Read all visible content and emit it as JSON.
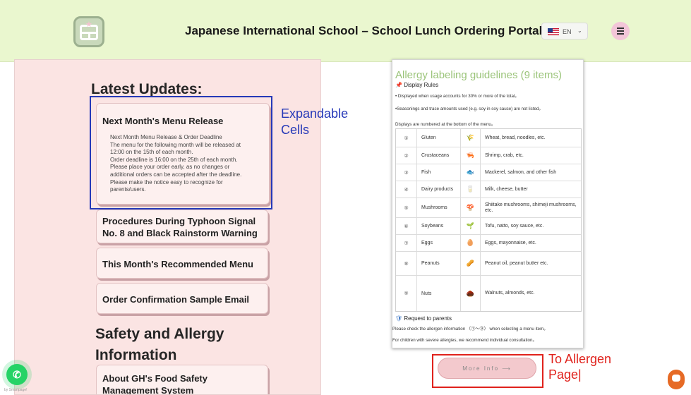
{
  "header": {
    "title": "Japanese International School – School Lunch Ordering Portal",
    "language": {
      "code": "EN"
    },
    "colors": {
      "header_bg": "#eaf7cf",
      "logo": "#c9d9bb",
      "menu_button": "#f3c6d8"
    }
  },
  "latest_updates": {
    "title": "Latest Updates:",
    "items": [
      {
        "title": "Next Month's Menu Release",
        "expanded": true,
        "body_lines": [
          "Next Month Menu Release & Order Deadline",
          "The menu for the following month will be released at",
          "12:00 on the 15th of each month.",
          "Order deadline is 16:00 on the 25th of each month.",
          "Please place your order early, as no changes or",
          "additional orders can be accepted after the deadline.",
          "Please make the notice easy to recognize for",
          "parents/users."
        ]
      },
      {
        "title_lines": [
          "Procedures During Typhoon Signal",
          "No. 8 and Black Rainstorm Warning"
        ]
      },
      {
        "title": "This Month's Recommended Menu"
      },
      {
        "title": "Order Confirmation Sample Email"
      }
    ]
  },
  "safety": {
    "title_lines": [
      "Safety and Allergy",
      "Information"
    ],
    "items": [
      {
        "title_lines": [
          "About GH's Food Safety",
          "Management System"
        ]
      }
    ]
  },
  "allergy_doc": {
    "title": "Allergy labeling guidelines (9 items)",
    "display_rules_label": "Display Rules",
    "rules": [
      "• Displayed when usage accounts for 30% or more of the total。",
      "•Seasonings and trace amounts used (e.g. soy in soy sauce) are not listed。"
    ],
    "numbering_note": "Displays are numbered at the bottom of the menu。",
    "allergens": [
      {
        "num": "①",
        "name": "Gluten",
        "icon": "wheat-icon",
        "glyph": "🌾",
        "examples": "Wheat, bread, noodles, etc."
      },
      {
        "num": "②",
        "name": "Crustaceans",
        "icon": "shrimp-icon",
        "glyph": "🦐",
        "examples": "Shrimp, crab, etc."
      },
      {
        "num": "③",
        "name": "Fish",
        "icon": "fish-icon",
        "glyph": "🐟",
        "examples": "Mackerel, salmon, and other fish"
      },
      {
        "num": "④",
        "name": "Dairy products",
        "icon": "milk-icon",
        "glyph": "🥛",
        "examples": "Milk, cheese, butter"
      },
      {
        "num": "⑤",
        "name": "Mushrooms",
        "icon": "mushroom-icon",
        "glyph": "🍄",
        "examples": "Shiitake mushrooms, shimeji mushrooms, etc."
      },
      {
        "num": "⑥",
        "name": "Soybeans",
        "icon": "sprout-icon",
        "glyph": "🌱",
        "examples": "Tofu, natto, soy sauce, etc."
      },
      {
        "num": "⑦",
        "name": "Eggs",
        "icon": "egg-icon",
        "glyph": "🥚",
        "examples": "Eggs, mayonnaise, etc."
      },
      {
        "num": "⑧",
        "name": "Peanuts",
        "icon": "peanut-icon",
        "glyph": "🥜",
        "examples": "Peanut oil, peanut butter  etc."
      },
      {
        "num": "⑨",
        "name": "Nuts",
        "icon": "nut-icon",
        "glyph": "🌰",
        "examples": "Walnuts, almonds, etc."
      }
    ],
    "request_title": "Request to parents",
    "request_lines": [
      "Please check the allergen information （①〜⑨） when selecting a menu item。",
      "For children with severe allergies, we recommend individual consultation。"
    ]
  },
  "more_info_button": {
    "label": "More Info  ⟶"
  },
  "annotations": {
    "expandable": [
      "Expandable",
      "Cells"
    ],
    "allergen_link": [
      "To Allergen",
      "Page|"
    ],
    "colors": {
      "blue": "#2538b8",
      "red": "#e0221c"
    }
  },
  "widgets": {
    "powered_by": "by Smartpage!"
  }
}
